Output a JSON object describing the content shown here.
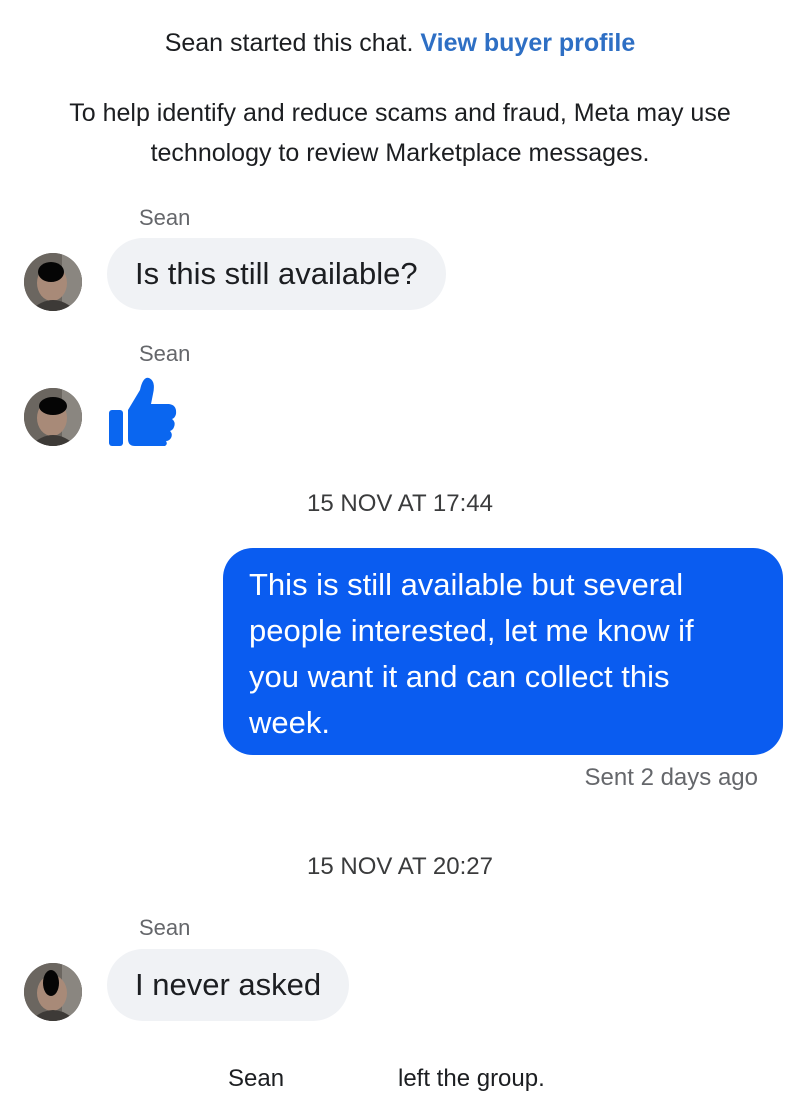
{
  "header": {
    "started_text": "Sean started this chat.",
    "profile_link": "View buyer profile",
    "notice_line1": "To help identify and reduce scams and fraud, Meta may use",
    "notice_line2": "technology to review Marketplace messages."
  },
  "messages": [
    {
      "sender": "Sean",
      "text": "Is this still available?"
    },
    {
      "sender": "Sean",
      "icon": "thumbs-up-icon"
    },
    {
      "timestamp": "15 NOV AT 17:44"
    },
    {
      "sender": "me",
      "lines": [
        "This is still available but several",
        "people interested, let me know if",
        "you want it and can collect this",
        "week."
      ],
      "status": "Sent 2 days ago"
    },
    {
      "timestamp": "15 NOV AT 20:27"
    },
    {
      "sender": "Sean",
      "text": "I never asked"
    }
  ],
  "footer": {
    "name": "Sean",
    "left_text": "left the group."
  },
  "colors": {
    "outgoing_bubble": "#0a5cf0",
    "incoming_bubble": "#f0f2f5",
    "link": "#2e6fc4",
    "thumbs_up": "#0a66f0"
  }
}
